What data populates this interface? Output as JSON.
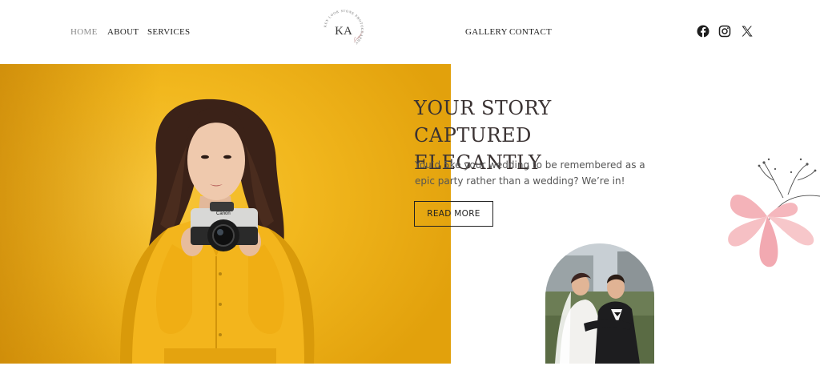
{
  "nav": {
    "left": [
      {
        "label": "HOME",
        "active": true
      },
      {
        "label": "ABOUT",
        "active": false
      },
      {
        "label": "SERVICES",
        "active": false
      }
    ],
    "right": [
      {
        "label": "GALLERY"
      },
      {
        "label": "CONTACT"
      }
    ],
    "logo": {
      "monogram": "KA",
      "ring_text": "KEY LOOK STONE PHOTOGRAPHY"
    },
    "social": [
      {
        "name": "facebook-icon"
      },
      {
        "name": "instagram-icon"
      },
      {
        "name": "x-icon"
      }
    ]
  },
  "hero": {
    "title": "YOUR STORY CAPTURED\nELEGANTLY",
    "text": "You’d 5ke your wedding to be remembered as a epic party rather than a wedding? We’re in!",
    "button": "READ MORE",
    "camera_brand": "Canon"
  },
  "colors": {
    "accent_yellow": "#f2b81e",
    "text_dark": "#2b2b2b",
    "flower_pink": "#f6b8bd"
  }
}
